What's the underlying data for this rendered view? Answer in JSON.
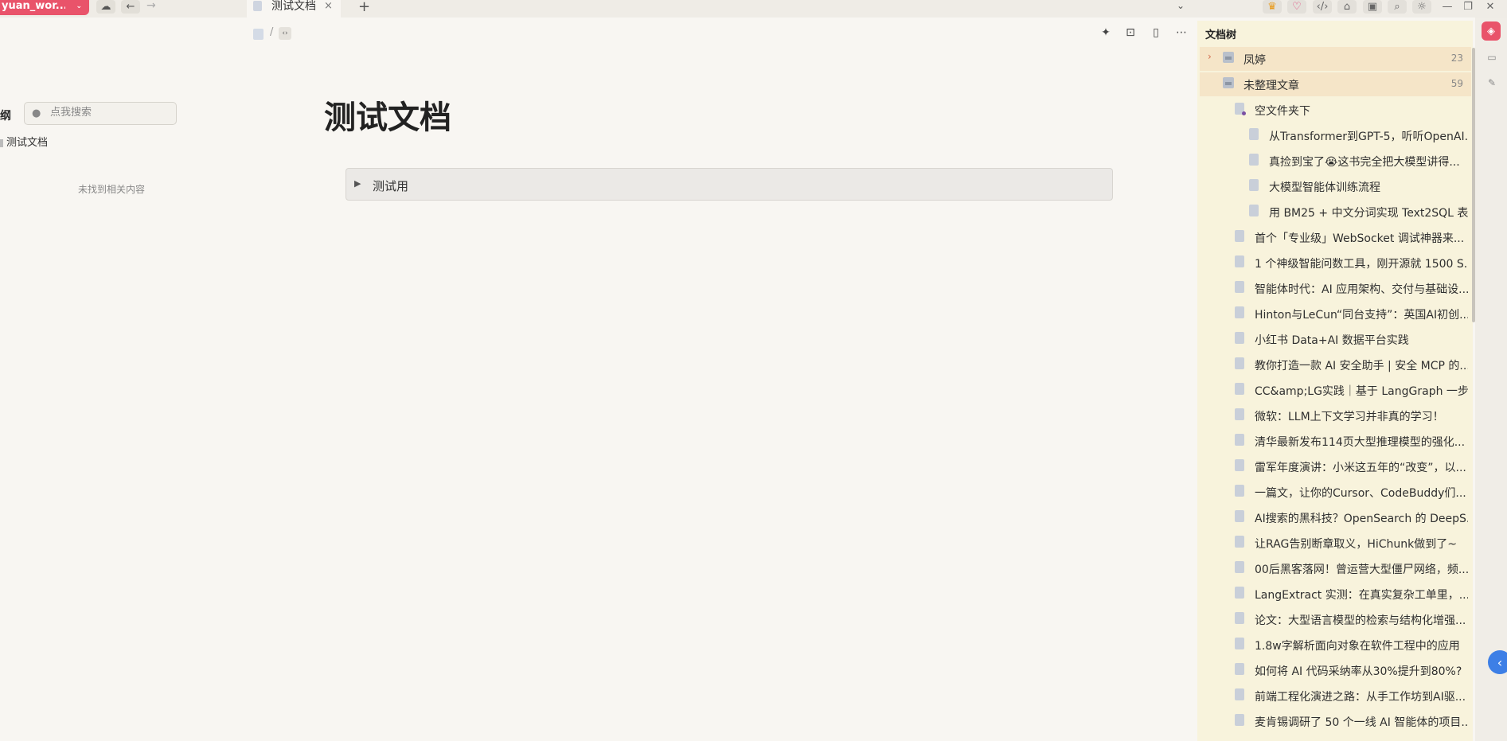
{
  "workspace": {
    "name": "yuan_wor..."
  },
  "tab": {
    "title": "测试文档",
    "close": "×",
    "add": "+"
  },
  "outline": {
    "title": "纲",
    "search_placeholder": "点我搜索",
    "items": [
      "测试文档"
    ],
    "empty_text": "未找到相关内容"
  },
  "document": {
    "title": "测试文档",
    "blocks": [
      {
        "type": "toggle",
        "label": "测试用"
      }
    ]
  },
  "tree": {
    "title": "文档树",
    "notebooks": [
      {
        "name": "凤婷",
        "count": "23"
      },
      {
        "name": "未整理文章",
        "count": "59"
      }
    ],
    "folder": {
      "name": "空文件夹下"
    },
    "folder_docs": [
      "从Transformer到GPT-5，听听OpenAI...",
      "真捡到宝了😭这书完全把大模型讲得...",
      "大模型智能体训练流程",
      "用 BM25 + 中文分词实现 Text2SQL 表..."
    ],
    "docs": [
      "首个「专业级」WebSocket 调试神器来...",
      "1 个神级智能问数工具，刚开源就 1500 S...",
      "智能体时代：AI 应用架构、交付与基础设...",
      "Hinton与LeCun“同台支持”：英国AI初创...",
      "小红书 Data+AI 数据平台实践",
      "教你打造一款 AI 安全助手 | 安全 MCP 的...",
      "CC&amp;LG实践｜基于 LangGraph 一步...",
      "微软：LLM上下文学习并非真的学习！",
      "清华最新发布114页大型推理模型的强化...",
      "雷军年度演讲：小米这五年的“改变”，以...",
      "一篇文，让你的Cursor、CodeBuddy们...",
      "AI搜索的黑科技？OpenSearch 的 DeepS...",
      "让RAG告别断章取义，HiChunk做到了~",
      "00后黑客落网！曾运营大型僵尸网络，频...",
      "LangExtract 实测：在真实复杂工单里，...",
      "论文：大型语言模型的检索与结构化增强...",
      "1.8w字解析面向对象在软件工程中的应用",
      "如何将 AI 代码采纳率从30%提升到80%?",
      "前端工程化演进之路：从手工作坊到AI驱...",
      "麦肯锡调研了 50 个一线 AI 智能体的项目..."
    ]
  },
  "colors": {
    "accent": "#e9536a",
    "tree_bg": "#f8f3dc",
    "notebook_bg": "#f5e5c8",
    "collapse_btn": "#3d7fe6"
  }
}
